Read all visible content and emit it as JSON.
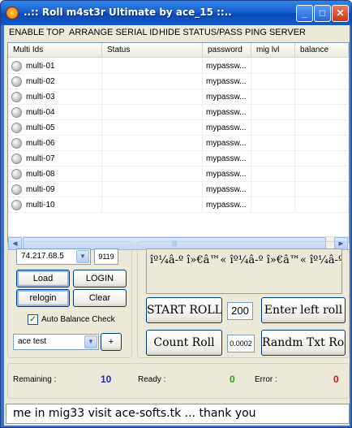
{
  "window": {
    "title": "..:: Roll m4st3r Ultimate by ace_15 ::..",
    "minimize_icon": "minimize-icon",
    "maximize_icon": "maximize-icon",
    "close_icon": "close-icon"
  },
  "menu": {
    "items": [
      "ENABLE TOP",
      "ARRANGE SERIAL ID",
      "HIDE STATUS/PASS",
      "PING SERVER"
    ]
  },
  "list": {
    "columns": [
      "Multi Ids",
      "Status",
      "password",
      "mig lvl",
      "balance"
    ],
    "rows": [
      {
        "id": "multi-01",
        "status": "",
        "password": "mypassw...",
        "lvl": "",
        "balance": ""
      },
      {
        "id": "multi-02",
        "status": "",
        "password": "mypassw...",
        "lvl": "",
        "balance": ""
      },
      {
        "id": "multi-03",
        "status": "",
        "password": "mypassw...",
        "lvl": "",
        "balance": ""
      },
      {
        "id": "multi-04",
        "status": "",
        "password": "mypassw...",
        "lvl": "",
        "balance": ""
      },
      {
        "id": "multi-05",
        "status": "",
        "password": "mypassw...",
        "lvl": "",
        "balance": ""
      },
      {
        "id": "multi-06",
        "status": "",
        "password": "mypassw...",
        "lvl": "",
        "balance": ""
      },
      {
        "id": "multi-07",
        "status": "",
        "password": "mypassw...",
        "lvl": "",
        "balance": ""
      },
      {
        "id": "multi-08",
        "status": "",
        "password": "mypassw...",
        "lvl": "",
        "balance": ""
      },
      {
        "id": "multi-09",
        "status": "",
        "password": "mypassw...",
        "lvl": "",
        "balance": ""
      },
      {
        "id": "multi-10",
        "status": "",
        "password": "mypassw...",
        "lvl": "",
        "balance": ""
      }
    ]
  },
  "server": {
    "ip": "74.217.68.5",
    "port": "9119"
  },
  "buttons": {
    "load": "Load",
    "login": "LOGIN",
    "relogin": "relogin",
    "clear": "Clear",
    "plus": "+",
    "start_roll": "START ROLL",
    "enter_left_roll": "Enter left roll",
    "count_roll": "Count Roll",
    "random_txt_roll": "Randm Txt Roll"
  },
  "auto_balance": {
    "label": "Auto Balance Check",
    "checked": true,
    "check_mark": "✓"
  },
  "room": {
    "value": "ace test"
  },
  "roll": {
    "count": "200",
    "delay": "0.0002"
  },
  "marquee": {
    "text": "îº¼â-º î»€â™« îº¼â-º î»€â™« îº¼â-º î»"
  },
  "status": {
    "remaining_label": "Remaining :",
    "remaining_value": "10",
    "ready_label": "Ready :",
    "ready_value": "0",
    "error_label": "Error :",
    "error_value": "0",
    "colors": {
      "remaining": "#1f1fcc",
      "ready": "#22a022",
      "error": "#cc1111"
    }
  },
  "footer": {
    "text": "me in mig33 visit ace-softs.tk ... thank you"
  }
}
